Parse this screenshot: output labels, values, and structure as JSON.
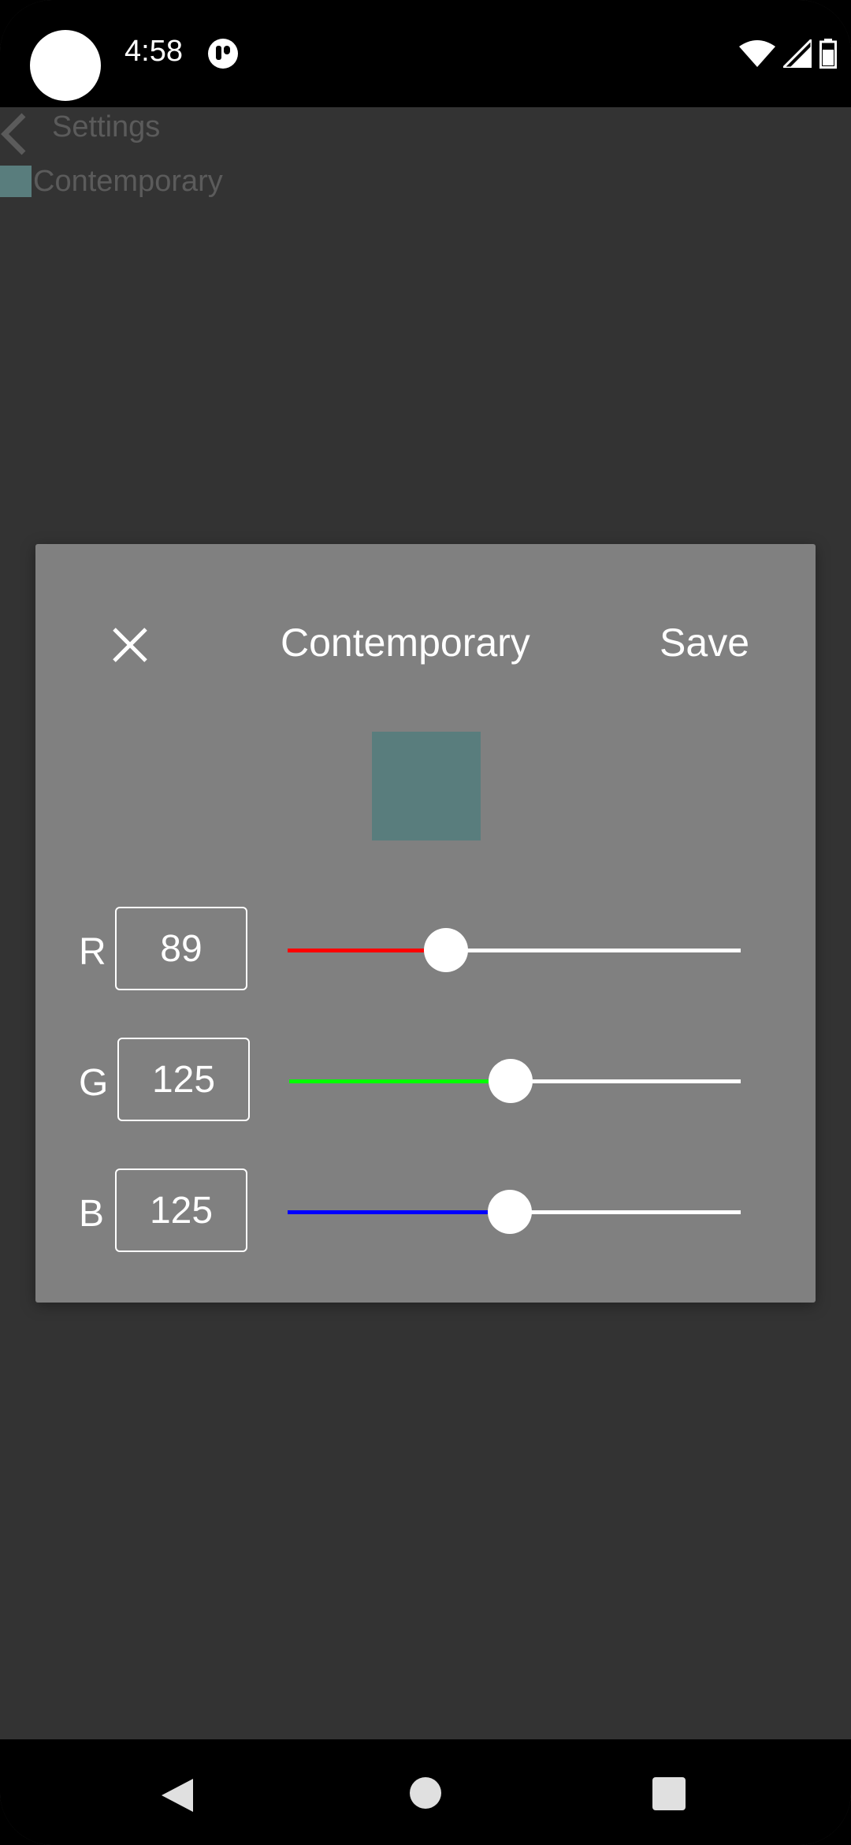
{
  "status_bar": {
    "time": "4:58",
    "icons": [
      "app-indicator-icon",
      "wifi-icon",
      "signal-icon",
      "battery-icon"
    ]
  },
  "background_screen": {
    "back_icon": "chevron-left-icon",
    "title": "Settings",
    "theme_item": {
      "name": "Contemporary",
      "color": "#597d7d"
    }
  },
  "dialog": {
    "close_icon": "close-icon",
    "title": "Contemporary",
    "save_label": "Save",
    "preview_color": "#597d7d",
    "channels": [
      {
        "label": "R",
        "value": "89",
        "fraction": 0.349,
        "color": "#ff0000"
      },
      {
        "label": "G",
        "value": "125",
        "fraction": 0.49,
        "color": "#00ff00"
      },
      {
        "label": "B",
        "value": "125",
        "fraction": 0.49,
        "color": "#0000ff"
      }
    ]
  },
  "nav_bar": {
    "icons": [
      "back-icon",
      "home-icon",
      "recents-icon"
    ]
  }
}
